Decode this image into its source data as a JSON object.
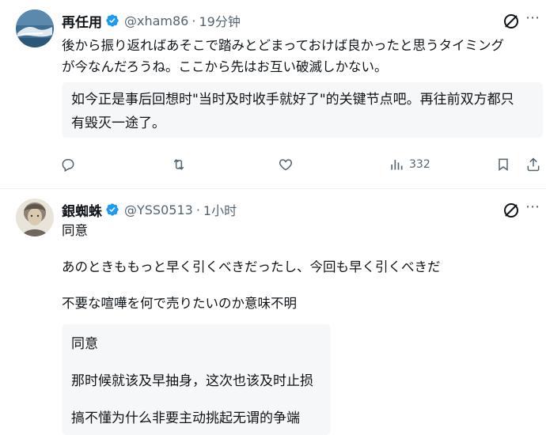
{
  "post1": {
    "name": "再任用",
    "handle": "@xham86",
    "sep": "·",
    "time": "19分钟",
    "text_line1": "後から振り返ればあそこで踏みとどまっておけば良かったと思うタイミング",
    "text_line2": "が今なんだろうね。ここから先はお互い破滅しかない。",
    "translation_line1": "如今正是事后回想时\"当时及时收手就好了\"的关键节点吧。再往前双方都只",
    "translation_line2": "有毁灭一途了。",
    "views": "332",
    "icons": [
      "avatar",
      "verified-badge-icon",
      "grok-icon",
      "more-icon",
      "reply-icon",
      "retweet-icon",
      "like-icon",
      "views-icon",
      "bookmark-icon",
      "share-icon"
    ]
  },
  "post2": {
    "name": "銀蜘蛛",
    "handle": "@YSS0513",
    "sep": "·",
    "time": "1小时",
    "line1": "同意",
    "line2": "あのときももっと早く引くべきだったし、今回も早く引くべきだ",
    "line3": "不要な喧嘩を何で売りたいのか意味不明",
    "translation_line1": "同意",
    "translation_line2": "那时候就该及早抽身，这次也该及时止损",
    "translation_line3": "搞不懂为什么非要主动挑起无谓的争端"
  },
  "colors": {
    "text": "#0f1419",
    "secondary": "#536471",
    "verified": "#1d9bf0",
    "translation_bg": "#f5f7f8"
  }
}
